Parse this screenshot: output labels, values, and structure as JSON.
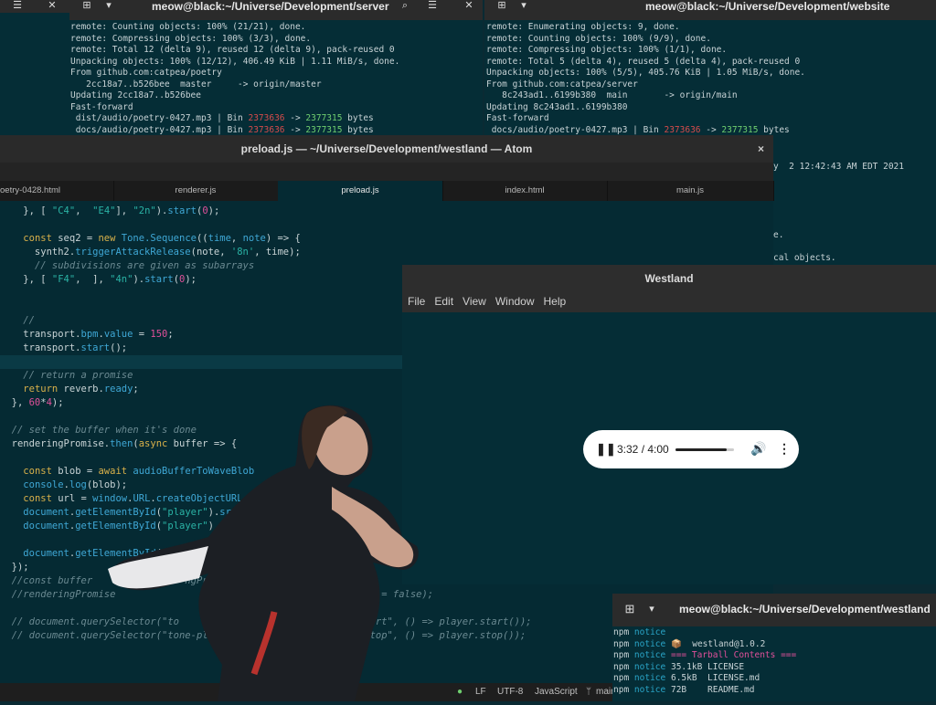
{
  "term_server": {
    "title": "meow@black:~/Universe/Development/server",
    "lines": [
      "remote: Counting objects: 100% (21/21), done.",
      "remote: Compressing objects: 100% (3/3), done.",
      "remote: Total 12 (delta 9), reused 12 (delta 9), pack-reused 0",
      "Unpacking objects: 100% (12/12), 406.49 KiB | 1.11 MiB/s, done.",
      "From github.com:catpea/poetry",
      "   2cc18a7..b526bee  master     -> origin/master",
      "Updating 2cc18a7..b526bee",
      "Fast-forward"
    ],
    "diff1_pre": " dist/audio/poetry-0427.mp3 | Bin ",
    "diff_old": "2373636",
    "diff_arrow": " -> ",
    "diff_new": "2377315",
    "diff_post": " bytes",
    "diff2_pre": " docs/audio/poetry-0427.mp3 | Bin "
  },
  "term_website": {
    "title": "meow@black:~/Universe/Development/website",
    "lines": [
      "remote: Enumerating objects: 9, done.",
      "remote: Counting objects: 100% (9/9), done.",
      "remote: Compressing objects: 100% (1/1), done.",
      "remote: Total 5 (delta 4), reused 5 (delta 4), pack-reused 0",
      "Unpacking objects: 100% (5/5), 405.76 KiB | 1.05 MiB/s, done.",
      "From github.com:catpea/server",
      "   8c243ad1..6199b380  main       -> origin/main",
      "Updating 8c243ad1..6199b380",
      "Fast-forward"
    ],
    "diff_pre": " docs/audio/poetry-0427.mp3 | Bin ",
    "diff_old": "2373636",
    "diff_arrow": " -> ",
    "diff_new": "2377315",
    "diff_post": " bytes",
    "partial_date": "y  2 12:42:43 AM EDT 2021",
    "partial_e": "e.",
    "partial_objects": "cal objects."
  },
  "atom": {
    "title": "preload.js — ~/Universe/Development/westland — Atom",
    "close": "×",
    "tabs": [
      "oetry-0428.html",
      "renderer.js",
      "preload.js",
      "index.html",
      "main.js"
    ],
    "status": {
      "lf": "LF",
      "enc": "UTF-8",
      "lang": "JavaScript",
      "branch": "main"
    }
  },
  "westland": {
    "title": "Westland",
    "menu": [
      "File",
      "Edit",
      "View",
      "Window",
      "Help"
    ],
    "player": {
      "time": "3:32 / 4:00",
      "progress": 0.88
    }
  },
  "term_westland": {
    "title": "meow@black:~/Universe/Development/westland",
    "npm": "npm",
    "notice": "notice",
    "lines": [
      {
        "text": "",
        "cyan": false
      },
      {
        "text": "📦  westland@1.0.2",
        "cyan": false
      },
      {
        "text": "=== Tarball Contents ===",
        "cyan": true
      },
      {
        "text": "35.1kB LICENSE",
        "cyan": false
      },
      {
        "text": "6.5kB  LICENSE.md",
        "cyan": false
      },
      {
        "text": "72B    README.md",
        "cyan": false
      }
    ]
  }
}
